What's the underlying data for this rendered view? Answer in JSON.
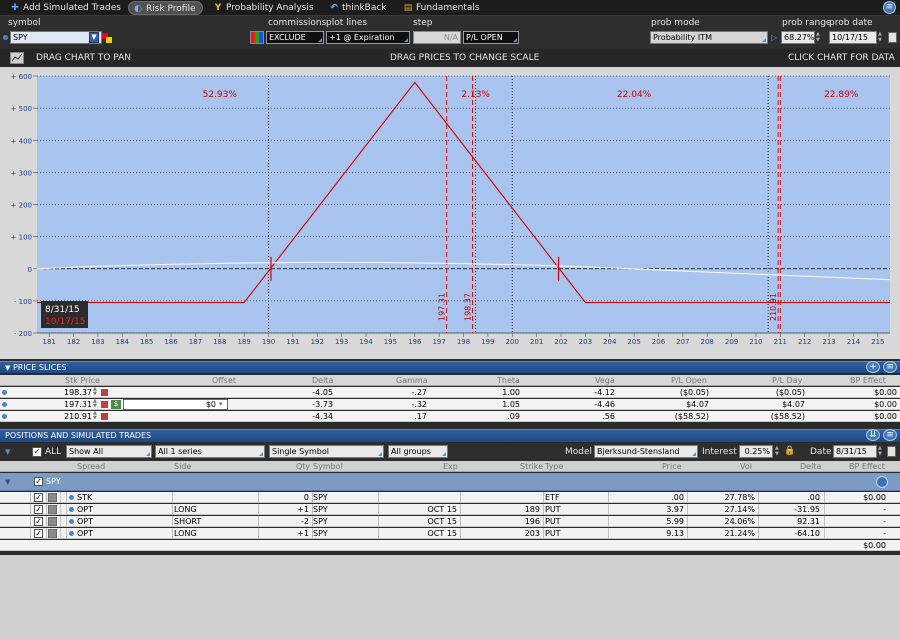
{
  "topnav": {
    "tabs": [
      {
        "label": "Add Simulated Trades",
        "icon": "plus-icon"
      },
      {
        "label": "Risk Profile",
        "icon": "risk-profile-icon"
      },
      {
        "label": "Probability Analysis",
        "icon": "probability-icon"
      },
      {
        "label": "thinkBack",
        "icon": "thinkback-icon"
      },
      {
        "label": "Fundamentals",
        "icon": "fundamentals-icon"
      }
    ]
  },
  "controls": {
    "symbol_label": "symbol",
    "symbol_value": "SPY",
    "commissions_label": "commissions",
    "commissions_value": "EXCLUDE",
    "plot_lines_label": "plot lines",
    "plot_lines_value": "+1 @ Expiration",
    "step_label": "step",
    "step_value": "N/A",
    "pl_mode_value": "P/L OPEN",
    "prob_mode_label": "prob mode",
    "prob_mode_value": "Probability ITM",
    "prob_range_label": "prob range",
    "prob_range_value": "68.27%",
    "prob_date_label": "prob date",
    "prob_date_value": "10/17/15"
  },
  "chart_header": {
    "pan_label": "DRAG CHART TO PAN",
    "scale_label": "DRAG PRICES TO CHANGE SCALE",
    "click_label": "CLICK CHART FOR DATA"
  },
  "chart_data": {
    "type": "line",
    "title": "",
    "xlabel": "",
    "ylabel": "",
    "xlim": [
      180.5,
      215.5
    ],
    "ylim": [
      -200,
      600
    ],
    "x_ticks": [
      181,
      182,
      183,
      184,
      185,
      186,
      187,
      188,
      189,
      190,
      191,
      192,
      193,
      194,
      195,
      196,
      197,
      198,
      199,
      200,
      201,
      202,
      203,
      204,
      205,
      206,
      207,
      208,
      209,
      210,
      211,
      212,
      213,
      214,
      215
    ],
    "y_ticks": [
      {
        "v": 600,
        "label": "+ 600"
      },
      {
        "v": 500,
        "label": "+ 500"
      },
      {
        "v": 400,
        "label": "+ 400"
      },
      {
        "v": 300,
        "label": "+ 300"
      },
      {
        "v": 200,
        "label": "+ 200"
      },
      {
        "v": 100,
        "label": "+ 100"
      },
      {
        "v": 0,
        "label": "0"
      },
      {
        "v": -100,
        "label": "- 100"
      },
      {
        "v": -200,
        "label": "- 200"
      }
    ],
    "series": [
      {
        "values_at": "expiration",
        "color": "#d10000",
        "points": [
          [
            180.5,
            -105
          ],
          [
            189,
            -105
          ],
          [
            196,
            580
          ],
          [
            203,
            -105
          ],
          [
            215.5,
            -105
          ]
        ]
      },
      {
        "values_at": "today",
        "color": "#f2f2f2",
        "points": [
          [
            180.5,
            0
          ],
          [
            183,
            8
          ],
          [
            186,
            14
          ],
          [
            189,
            18
          ],
          [
            192,
            20
          ],
          [
            195,
            19
          ],
          [
            198,
            16
          ],
          [
            201,
            11
          ],
          [
            204,
            3
          ],
          [
            207,
            -7
          ],
          [
            210,
            -17
          ],
          [
            213,
            -26
          ],
          [
            215.5,
            -34
          ]
        ]
      }
    ],
    "black_dotted_x": [
      190,
      198.5,
      200,
      210.5
    ],
    "red_dashed": [
      {
        "x": 197.31,
        "label": "197.31"
      },
      {
        "x": 198.37,
        "label": "198.37"
      },
      {
        "x": 210.91,
        "label": "210.91"
      },
      {
        "x": 211,
        "label": ""
      }
    ],
    "probabilities": [
      {
        "x": 188,
        "label": "52.93%"
      },
      {
        "x": 198.5,
        "label": "2.13%"
      },
      {
        "x": 205,
        "label": "22.04%"
      },
      {
        "x": 213.5,
        "label": "22.89%"
      }
    ],
    "breakevens": [
      190.1,
      201.9
    ],
    "date_labels": [
      "8/31/15",
      "10/17/15"
    ]
  },
  "price_slices": {
    "title": "PRICE SLICES",
    "columns": [
      "Stk Price",
      "Offset",
      "Delta",
      "Gamma",
      "Theta",
      "Vega",
      "P/L Open",
      "P/L Day",
      "BP Effect"
    ],
    "rows": [
      {
        "stk": "198.37",
        "offset": "",
        "delta": "-4.05",
        "gamma": "-.27",
        "theta": "1.00",
        "vega": "-4.12",
        "pl_open": "($0.05)",
        "pl_day": "($0.05)",
        "bp": "$0.00"
      },
      {
        "stk": "197.31",
        "offset": "$0",
        "delta": "-3.73",
        "gamma": "-.32",
        "theta": "1.05",
        "vega": "-4.46",
        "pl_open": "$4.07",
        "pl_day": "$4.07",
        "bp": "$0.00"
      },
      {
        "stk": "210.91",
        "offset": "",
        "delta": "-4.34",
        "gamma": ".17",
        "theta": ".09",
        "vega": ".56",
        "pl_open": "($58.52)",
        "pl_day": "($58.52)",
        "bp": "$0.00"
      }
    ]
  },
  "positions": {
    "title": "POSITIONS AND SIMULATED TRADES",
    "all_label": "ALL",
    "show_value": "Show All",
    "series_value": "All 1 series",
    "symbol_filter": "Single Symbol",
    "groups_value": "All groups",
    "model_label": "Model",
    "model_value": "Bjerksund-Stensland",
    "interest_label": "Interest",
    "interest_value": "0.25%",
    "date_label": "Date",
    "date_value": "8/31/15",
    "columns": [
      "Spread",
      "Side",
      "Qty",
      "Symbol",
      "Exp",
      "Strike",
      "Type",
      "Price",
      "Vol",
      "Delta",
      "BP Effect"
    ],
    "group_label": "SPY",
    "rows": [
      {
        "spread": "STK",
        "side": "",
        "qty": "0",
        "symbol": "SPY",
        "exp": "",
        "strike": "",
        "type": "ETF",
        "price": ".00",
        "vol": "27.78%",
        "delta": ".00",
        "bp": "$0.00"
      },
      {
        "spread": "OPT",
        "side": "LONG",
        "qty": "+1",
        "symbol": "SPY",
        "exp": "OCT 15",
        "strike": "189",
        "type": "PUT",
        "price": "3.97",
        "vol": "27.14%",
        "delta": "-31.95",
        "bp": "-"
      },
      {
        "spread": "OPT",
        "side": "SHORT",
        "qty": "-2",
        "symbol": "SPY",
        "exp": "OCT 15",
        "strike": "196",
        "type": "PUT",
        "price": "5.99",
        "vol": "24.06%",
        "delta": "92.31",
        "bp": "-"
      },
      {
        "spread": "OPT",
        "side": "LONG",
        "qty": "+1",
        "symbol": "SPY",
        "exp": "OCT 15",
        "strike": "203",
        "type": "PUT",
        "price": "9.13",
        "vol": "21.24%",
        "delta": "-64.10",
        "bp": "-"
      }
    ],
    "total_bp": "$0.00"
  }
}
